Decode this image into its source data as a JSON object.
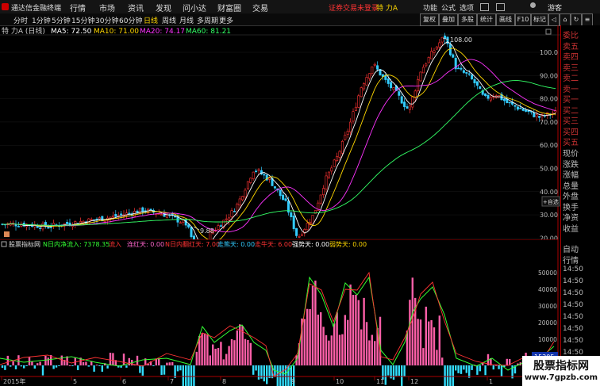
{
  "titlebar": {
    "app_name": "通达信金融终端",
    "menus": [
      "行情",
      "市场",
      "资讯",
      "发现",
      "问小达",
      "财富圈",
      "交易"
    ],
    "right_menus": [
      "功能",
      "公式",
      "选项"
    ],
    "alert": "证券交易未登录",
    "stock": "特 力A",
    "guest": "游客"
  },
  "periods": [
    "分时",
    "1分钟",
    "5分钟",
    "15分钟",
    "30分钟",
    "60分钟",
    "日线",
    "周线",
    "月线",
    "多周期",
    "更多"
  ],
  "toolbar": [
    "复权",
    "叠加",
    "多股",
    "统计",
    "画线",
    "F10",
    "标记"
  ],
  "toolbar_icons": [
    "back-icon",
    "home-icon",
    "refresh-icon",
    "menu-icon"
  ],
  "main": {
    "title": "特 力A (日线)",
    "ma": [
      {
        "label": "MA5: 72.50",
        "color": "#ffffff"
      },
      {
        "label": "MA10: 71.00",
        "color": "#ffd700"
      },
      {
        "label": "MA20: 74.17",
        "color": "#ff33ff"
      },
      {
        "label": "MA60: 81.21",
        "color": "#33ff66"
      }
    ],
    "price_axis": [
      "100.0",
      "90.00",
      "80.00",
      "70.00",
      "60.00",
      "50.00",
      "40.00",
      "30.00",
      "20.00"
    ],
    "high_label": "108.00",
    "low_label": "9.88",
    "back_btn": "返回",
    "add_btn": "+自选"
  },
  "sub": {
    "indicator_name": "股票指标网",
    "items": [
      {
        "label": "N日内净流入: 7378.35",
        "color": "#33ff33"
      },
      {
        "label": "流入",
        "color": "#ff3333"
      },
      {
        "label": "连红天: 0.00",
        "color": "#ff66cc"
      },
      {
        "label": "N日内翻红天: 7.00",
        "color": "#ff3333"
      },
      {
        "label": "走熊天: 0.00",
        "color": "#33ccff"
      },
      {
        "label": "走牛天: 6.00",
        "color": "#ff3333"
      },
      {
        "label": "强势天: 0.00",
        "color": "#ffffff"
      },
      {
        "label": "弱势天: 0.00",
        "color": "#ffd700"
      }
    ],
    "axis": [
      "50000",
      "40000",
      "30000",
      "20000",
      "10000",
      "0"
    ],
    "cursor_value": "15305"
  },
  "date_axis": [
    "2015年",
    "5",
    "6",
    "7",
    "8",
    "9",
    "10",
    "11",
    "12",
    "1"
  ],
  "right_panel": {
    "labels_red": [
      "委比",
      "卖五",
      "卖四",
      "卖三",
      "卖二",
      "卖一",
      "买一",
      "买二",
      "买三",
      "买四",
      "买五"
    ],
    "labels_gray": [
      "现价",
      "涨跌",
      "涨幅",
      "总量",
      "外盘",
      "换手",
      "净资",
      "收益"
    ],
    "bottom_labels": [
      "自动",
      "行情"
    ],
    "times": [
      "14:50",
      "14:50",
      "14:50",
      "14:50",
      "14:50",
      "14:50",
      "14:50",
      "14:50",
      "14:50",
      "14:50"
    ]
  },
  "watermark": {
    "line1": "股票指标网",
    "line2": "www.7gpzb.com"
  }
}
